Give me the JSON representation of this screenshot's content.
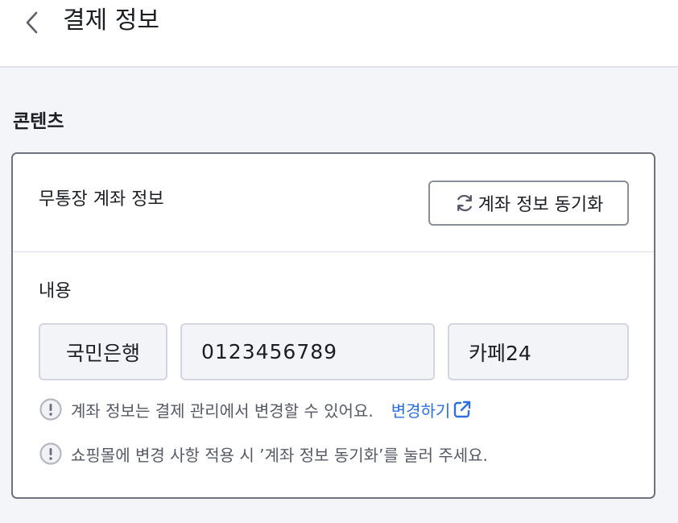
{
  "header": {
    "title": "결제 정보",
    "back_icon": "chevron-left-icon"
  },
  "section": {
    "label": "콘텐츠"
  },
  "card": {
    "title": "무통장 계좌 정보",
    "sync_button": {
      "label": "계좌 정보 동기화",
      "icon": "refresh-icon"
    },
    "content_label": "내용",
    "fields": {
      "bank": "국민은행",
      "account": "0123456789",
      "holder": "카페24"
    },
    "notes": [
      {
        "text": "계좌 정보는 결제 관리에서 변경할 수 있어요.",
        "link_label": "변경하기",
        "icon": "info-circle-icon"
      },
      {
        "text": "쇼핑몰에 변경 사항 적용 시 ’계좌 정보 동기화’를 눌러 주세요.",
        "icon": "info-circle-icon"
      }
    ]
  },
  "colors": {
    "link": "#2d6fe0",
    "border": "#6f7380",
    "field_bg": "#f3f4f7",
    "page_bg": "#f4f5f8"
  }
}
